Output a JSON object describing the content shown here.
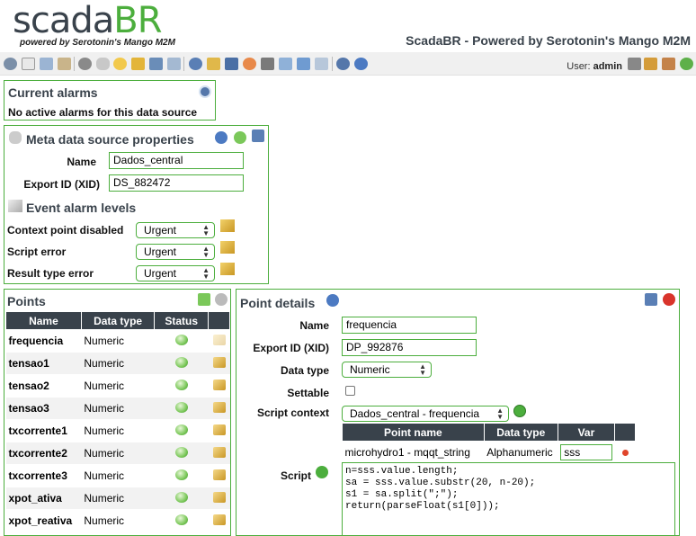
{
  "header": {
    "logo_part1": "scada",
    "logo_part2": "BR",
    "logo_tagline": "powered by Serotonin's Mango M2M",
    "page_title": "ScadaBR - Powered by Serotonin's Mango M2M"
  },
  "toolbar": {
    "user_label": "User:",
    "username": "admin"
  },
  "current_alarms": {
    "title": "Current alarms",
    "message": "No active alarms for this data source"
  },
  "ds_properties": {
    "title": "Meta data source properties",
    "name_label": "Name",
    "name_value": "Dados_central",
    "xid_label": "Export ID (XID)",
    "xid_value": "DS_882472",
    "event_title": "Event alarm levels",
    "alarms": [
      {
        "label": "Context point disabled",
        "level": "Urgent"
      },
      {
        "label": "Script error",
        "level": "Urgent"
      },
      {
        "label": "Result type error",
        "level": "Urgent"
      }
    ]
  },
  "points": {
    "title": "Points",
    "columns": [
      "Name",
      "Data type",
      "Status"
    ],
    "rows": [
      {
        "name": "frequencia",
        "type": "Numeric"
      },
      {
        "name": "tensao1",
        "type": "Numeric"
      },
      {
        "name": "tensao2",
        "type": "Numeric"
      },
      {
        "name": "tensao3",
        "type": "Numeric"
      },
      {
        "name": "txcorrente1",
        "type": "Numeric"
      },
      {
        "name": "txcorrente2",
        "type": "Numeric"
      },
      {
        "name": "txcorrente3",
        "type": "Numeric"
      },
      {
        "name": "xpot_ativa",
        "type": "Numeric"
      },
      {
        "name": "xpot_reativa",
        "type": "Numeric"
      }
    ]
  },
  "point_details": {
    "title": "Point details",
    "name_label": "Name",
    "name_value": "frequencia",
    "xid_label": "Export ID (XID)",
    "xid_value": "DP_992876",
    "datatype_label": "Data type",
    "datatype_value": "Numeric",
    "settable_label": "Settable",
    "context_label": "Script context",
    "context_value": "Dados_central - frequencia",
    "context_columns": [
      "Point name",
      "Data type",
      "Var"
    ],
    "context_rows": [
      {
        "point": "microhydro1 - mqqt_string",
        "type": "Alphanumeric",
        "var": "sss"
      }
    ],
    "script_label": "Script",
    "script": "n=sss.value.length;\nsa = sss.value.substr(20, n-20);\ns1 = sa.split(\";\");\nreturn(parseFloat(s1[0]));"
  },
  "colors": {
    "accent": "#4cae3d",
    "header_bg": "#39424b"
  }
}
